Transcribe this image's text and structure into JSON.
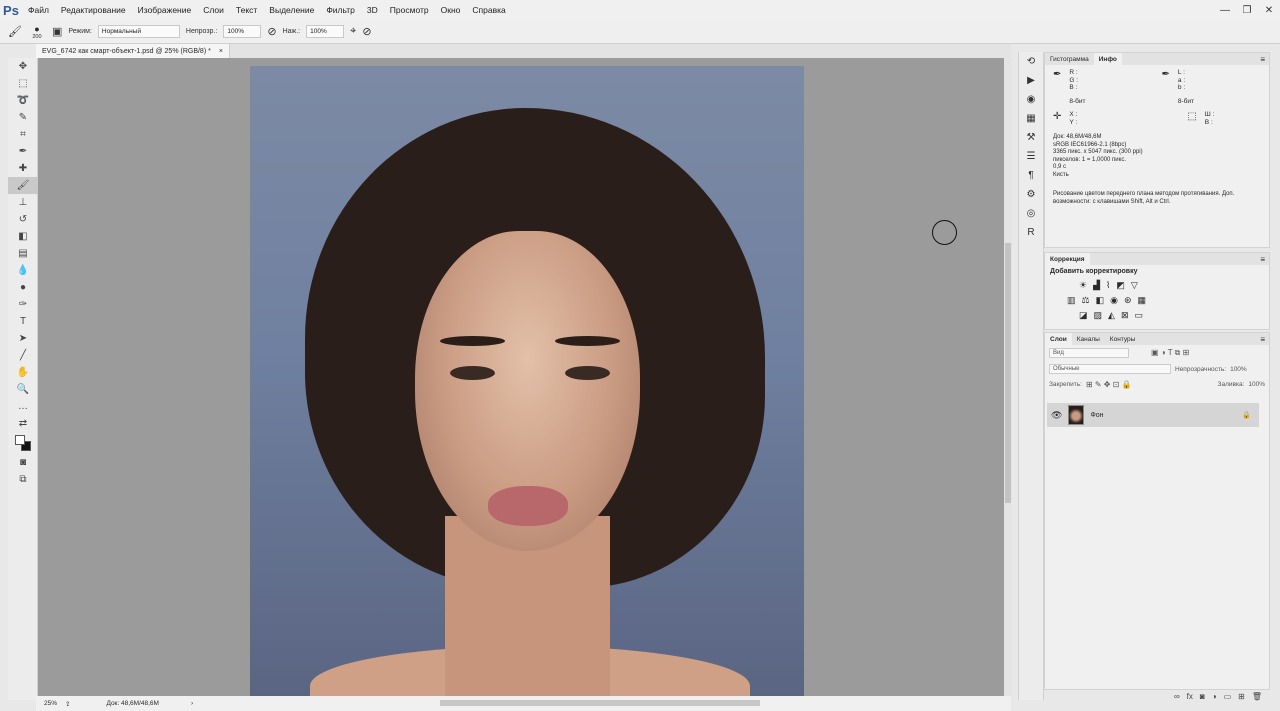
{
  "app": {
    "logo": "Ps"
  },
  "menu": [
    "Файл",
    "Редактирование",
    "Изображение",
    "Слои",
    "Текст",
    "Выделение",
    "Фильтр",
    "3D",
    "Просмотр",
    "Окно",
    "Справка"
  ],
  "window_controls": {
    "minimize": "—",
    "restore": "❐",
    "close": "✕"
  },
  "options": {
    "brush_size": "200",
    "mode_label": "Режим:",
    "mode_value": "Нормальный",
    "opacity_label": "Непрозр.:",
    "opacity_value": "100%",
    "flow_label": "Наж.:",
    "flow_value": "100%"
  },
  "document": {
    "tab_title": "EVG_6742 как смарт-объект-1.psd @ 25% (RGB/8) *",
    "close": "×"
  },
  "status": {
    "zoom": "25%",
    "doc_size": "Док: 48,6M/48,6M",
    "arrow": "›"
  },
  "info_panel": {
    "tabs": [
      "Гистограмма",
      "Инфо"
    ],
    "rgb": [
      "R :",
      "G :",
      "B :"
    ],
    "lab": [
      "L :",
      "a :",
      "b :"
    ],
    "bits_left": "8-бит",
    "bits_right": "8-бит",
    "xy": [
      "X :",
      "Y :"
    ],
    "wh": [
      "Ш :",
      "В :"
    ],
    "doc_lines": [
      "Док: 48,6M/48,6M",
      "sRGB IEC61966-2.1 (8bpc)",
      "3365 пикс. x 5047 пикс. (300 ppi)",
      "пикселов: 1 = 1,0000 пикс.",
      "0,9 с",
      "Кисть"
    ],
    "hint": "Рисование цветом переднего плана методом протягивания. Доп. возможности: с клавишами Shift, Alt и Ctrl."
  },
  "adjustments": {
    "title": "Коррекция",
    "subtitle": "Добавить корректировку"
  },
  "layers": {
    "tabs": [
      "Слои",
      "Каналы",
      "Контуры"
    ],
    "filter_placeholder": "Вид",
    "blend_mode": "Обычные",
    "opacity_label": "Непрозрачность:",
    "opacity_value": "100%",
    "lock_label": "Закрепить:",
    "fill_label": "Заливка:",
    "fill_value": "100%",
    "layer_name": "Фон"
  }
}
